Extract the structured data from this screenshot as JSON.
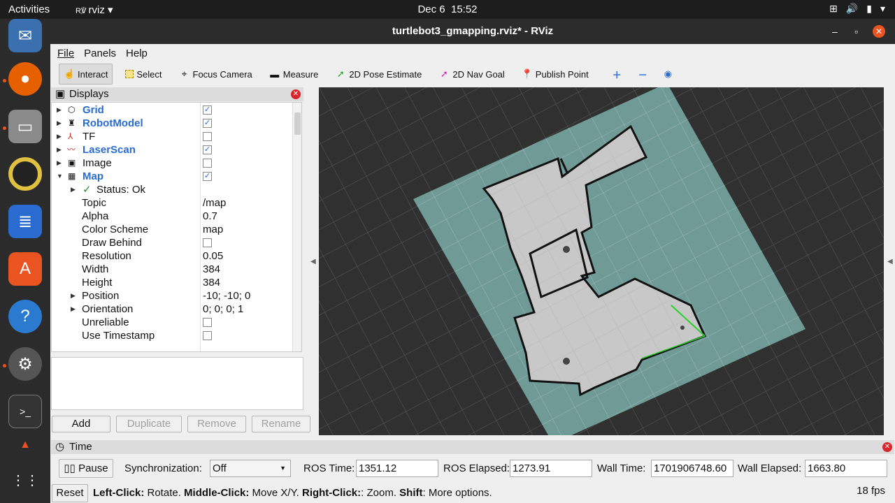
{
  "topbar": {
    "activities": "Activities",
    "app": "rviz",
    "date": "Dec 6",
    "time": "15:52"
  },
  "window": {
    "title": "turtlebot3_gmapping.rviz* - RViz"
  },
  "menu": [
    "File",
    "Panels",
    "Help"
  ],
  "toolbar": {
    "interact": "Interact",
    "select": "Select",
    "focus_camera": "Focus Camera",
    "measure": "Measure",
    "pose_estimate": "2D Pose Estimate",
    "nav_goal": "2D Nav Goal",
    "publish_point": "Publish Point"
  },
  "displays": {
    "title": "Displays",
    "items": [
      {
        "name": "Grid",
        "checked": true,
        "icon": "grid-icon"
      },
      {
        "name": "RobotModel",
        "checked": true,
        "icon": "robot-icon"
      },
      {
        "name": "TF",
        "checked": false,
        "icon": "axes-icon"
      },
      {
        "name": "LaserScan",
        "checked": true,
        "icon": "laser-icon"
      },
      {
        "name": "Image",
        "checked": false,
        "icon": "image-icon"
      },
      {
        "name": "Map",
        "checked": true,
        "icon": "map-icon"
      }
    ],
    "map_props": {
      "status": "Status: Ok",
      "topic_label": "Topic",
      "topic": "/map",
      "alpha_label": "Alpha",
      "alpha": "0.7",
      "color_scheme_label": "Color Scheme",
      "color_scheme": "map",
      "draw_behind_label": "Draw Behind",
      "resolution_label": "Resolution",
      "resolution": "0.05",
      "width_label": "Width",
      "width": "384",
      "height_label": "Height",
      "height": "384",
      "position_label": "Position",
      "position": "-10; -10; 0",
      "orientation_label": "Orientation",
      "orientation": "0; 0; 0; 1",
      "unreliable_label": "Unreliable",
      "use_timestamp_label": "Use Timestamp"
    },
    "buttons": {
      "add": "Add",
      "duplicate": "Duplicate",
      "remove": "Remove",
      "rename": "Rename"
    }
  },
  "time": {
    "title": "Time",
    "pause": "Pause",
    "sync_label": "Synchronization:",
    "sync_value": "Off",
    "ros_time_label": "ROS Time:",
    "ros_time": "1351.12",
    "ros_elapsed_label": "ROS Elapsed:",
    "ros_elapsed": "1273.91",
    "wall_time_label": "Wall Time:",
    "wall_time": "1701906748.60",
    "wall_elapsed_label": "Wall Elapsed:",
    "wall_elapsed": "1663.80"
  },
  "status": {
    "reset": "Reset",
    "left_click": "Left-Click:",
    "left_desc": " Rotate. ",
    "middle_click": "Middle-Click:",
    "middle_desc": " Move X/Y. ",
    "right_click": "Right-Click:",
    "right_desc": ": Zoom. ",
    "shift": "Shift",
    "shift_desc": ": More options.",
    "fps": "18 fps"
  },
  "colors": {
    "map_overlay": "#6f9a96",
    "map_free": "#c8c8c8",
    "wall": "#111111",
    "grid_line": "#5a5a5a",
    "ubuntu_orange": "#e95420"
  }
}
